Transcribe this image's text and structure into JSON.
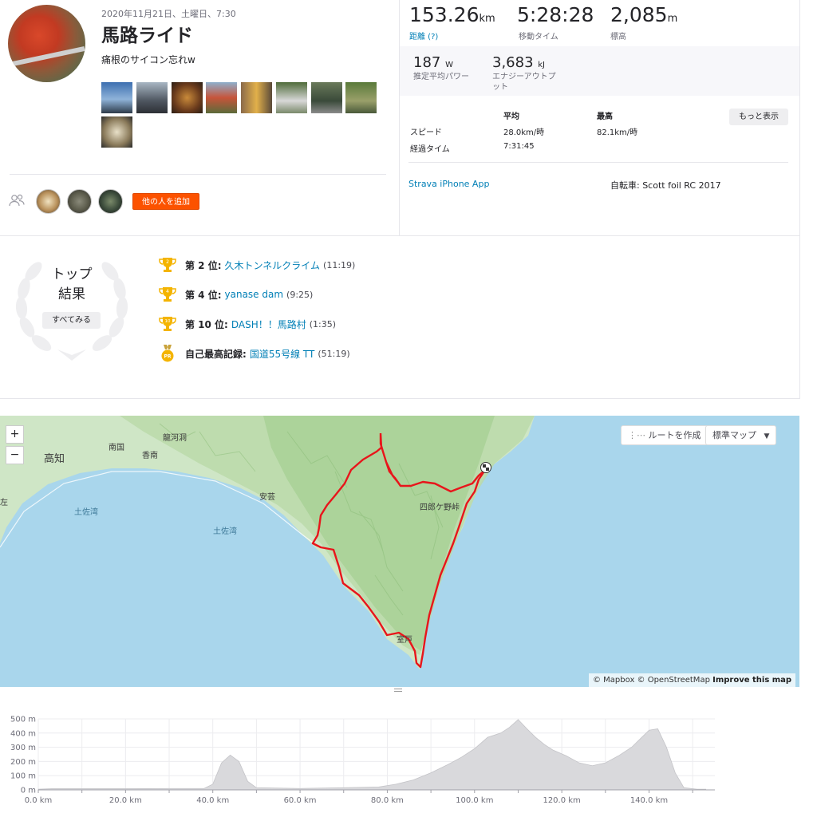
{
  "activity": {
    "date": "2020年11月21日、土曜日、7:30",
    "title": "馬路ライド",
    "description": "痛根のサイコン忘れw",
    "add_others_label": "他の人を追加",
    "photo_count": 9
  },
  "stats": {
    "distance": {
      "value": "153.26",
      "unit": "km",
      "label": "距離 (?)"
    },
    "moving_time": {
      "value": "5:28:28",
      "unit": "",
      "label": "移動タイム"
    },
    "elevation": {
      "value": "2,085",
      "unit": "m",
      "label": "標高"
    },
    "power": {
      "value": "187",
      "unit": "W",
      "label": "推定平均パワー"
    },
    "energy": {
      "value": "3,683",
      "unit": "kJ",
      "label": "エナジーアウトプ\nット"
    },
    "table": {
      "col_avg": "平均",
      "col_max": "最高",
      "speed_label": "スピード",
      "speed_avg": "28.0km/時",
      "speed_max": "82.1km/時",
      "elapsed_label": "経過タイム",
      "elapsed_value": "7:31:45"
    },
    "more_label": "もっと表示",
    "app_link": "Strava iPhone App",
    "bike": "自転車: Scott foil RC 2017"
  },
  "top_results": {
    "title_line1": "トップ",
    "title_line2": "結果",
    "see_all_label": "すべてみる",
    "items": [
      {
        "medal": "2",
        "rank": "第 2 位:",
        "segment": "久木トンネルクライム",
        "time": "(11:19)"
      },
      {
        "medal": "4",
        "rank": "第 4 位:",
        "segment": "yanase dam",
        "time": "(9:25)"
      },
      {
        "medal": "10",
        "rank": "第 10 位:",
        "segment": "DASH！！馬路村",
        "time": "(1:35)"
      },
      {
        "medal": "PR",
        "rank": "自己最高記録:",
        "segment": "国道55号線 TT",
        "time": "(51:19)"
      }
    ]
  },
  "map": {
    "zoom_in": "+",
    "zoom_out": "−",
    "route_button": "ルートを作成",
    "style_button": "標準マップ",
    "attribution_text": "© Mapbox © OpenStreetMap",
    "attribution_link": "Improve this map",
    "labels": {
      "kochi": "高知",
      "nankoku": "南国",
      "konan": "香南",
      "ryugado": "龍河洞",
      "aki": "安芸",
      "tosa_bay1": "土佐湾",
      "tosa_bay2": "土佐湾",
      "shirouka": "四郎ケ野峠",
      "muroto": "室戸",
      "edge_left": "左"
    }
  },
  "chart_data": {
    "type": "area",
    "title": "",
    "xlabel": "",
    "ylabel": "",
    "xlim": [
      0,
      153.26
    ],
    "ylim": [
      0,
      500
    ],
    "x_ticks": [
      "0.0 km",
      "20.0 km",
      "40.0 km",
      "60.0 km",
      "80.0 km",
      "100.0 km",
      "120.0 km",
      "140.0 km"
    ],
    "y_ticks": [
      "0 m",
      "100 m",
      "200 m",
      "300 m",
      "400 m",
      "500 m"
    ],
    "grid": true,
    "x": [
      0,
      3,
      10,
      20,
      30,
      38,
      40,
      42,
      44,
      46,
      48,
      50,
      60,
      70,
      78,
      82,
      86,
      90,
      94,
      97,
      100,
      103,
      106,
      108,
      110,
      112,
      114,
      116,
      118,
      121,
      124,
      127,
      130,
      133,
      136,
      138,
      140,
      142,
      144,
      146,
      148,
      151,
      153
    ],
    "elevation": [
      5,
      8,
      8,
      8,
      10,
      10,
      40,
      190,
      245,
      200,
      60,
      15,
      10,
      15,
      20,
      40,
      70,
      120,
      180,
      230,
      290,
      370,
      400,
      440,
      495,
      430,
      370,
      320,
      280,
      240,
      190,
      170,
      190,
      240,
      300,
      360,
      420,
      430,
      300,
      120,
      15,
      5,
      5
    ]
  }
}
